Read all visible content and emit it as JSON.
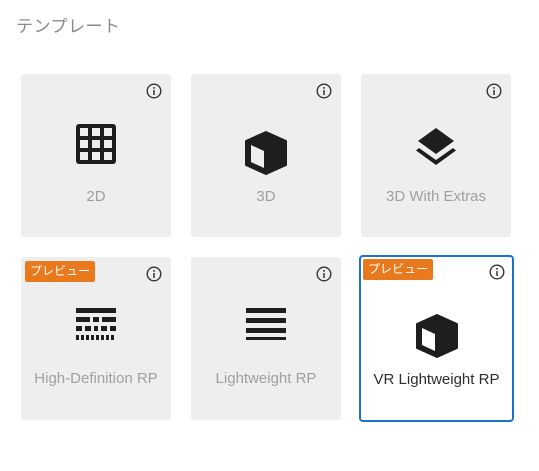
{
  "section": {
    "title": "テンプレート"
  },
  "templates": [
    {
      "label": "2D",
      "icon": "grid-icon",
      "badge": "",
      "selected": false
    },
    {
      "label": "3D",
      "icon": "cube-icon",
      "badge": "",
      "selected": false
    },
    {
      "label": "3D With Extras",
      "icon": "layers-icon",
      "badge": "",
      "selected": false
    },
    {
      "label": "High-Definition RP",
      "icon": "hd-rp-icon",
      "badge": "プレビュー",
      "selected": false
    },
    {
      "label": "Lightweight RP",
      "icon": "lines-icon",
      "badge": "",
      "selected": false
    },
    {
      "label": "VR Lightweight RP",
      "icon": "cube-icon",
      "badge": "プレビュー",
      "selected": true
    }
  ],
  "colors": {
    "card_bg": "#eeeeee",
    "selected_border": "#1a73c8",
    "badge_bg": "#e87a1d",
    "label_muted": "#a0a0a0",
    "label_selected": "#2d2d2d",
    "icon": "#1e1e1e"
  }
}
